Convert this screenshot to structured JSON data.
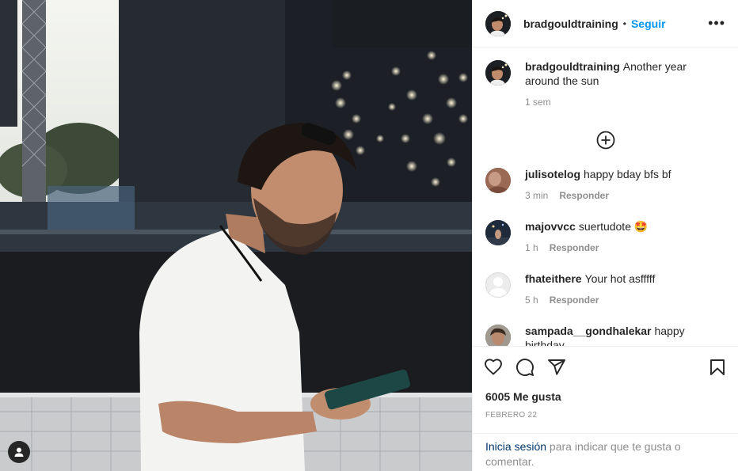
{
  "post": {
    "author": "bradgouldtraining",
    "separator": "•",
    "follow_label": "Seguir",
    "more_label": "•••"
  },
  "caption": {
    "username": "bradgouldtraining",
    "text": "Another year around the sun",
    "time": "1 sem"
  },
  "comments": [
    {
      "username": "julisotelog",
      "text": "happy bday bfs bf",
      "time": "3 min",
      "reply": "Responder"
    },
    {
      "username": "majovvcc",
      "text": "suertudote 🤩",
      "time": "1 h",
      "reply": "Responder"
    },
    {
      "username": "fhateithere",
      "text": "Your hot asfffff",
      "time": "5 h",
      "reply": "Responder"
    },
    {
      "username": "sampada__gondhalekar",
      "text": "happy birthday",
      "time": "",
      "reply": ""
    }
  ],
  "stats": {
    "likes": "6005 Me gusta",
    "date": "FEBRERO 22"
  },
  "login_prompt": {
    "link": "Inicia sesión",
    "text": " para indicar que te gusta o comentar."
  },
  "icons": {
    "like": "heart-icon",
    "comment": "comment-icon",
    "share": "share-icon",
    "save": "bookmark-icon",
    "load_more": "plus-circle-icon",
    "user": "user-icon"
  }
}
